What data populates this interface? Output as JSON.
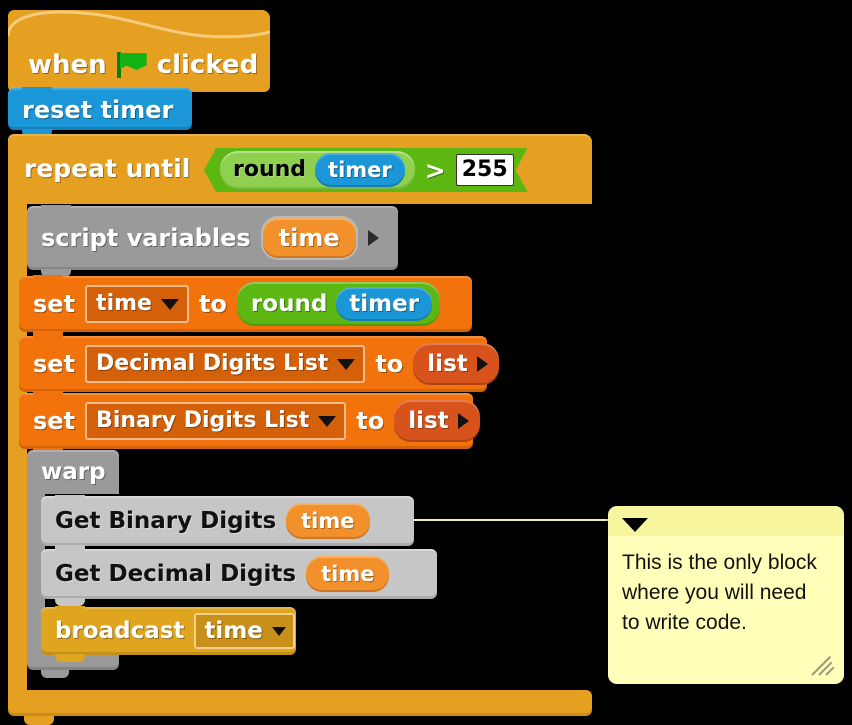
{
  "script": {
    "hat": {
      "label_when": "when",
      "label_clicked": "clicked",
      "icon": "green-flag-icon"
    },
    "reset_timer": {
      "label": "reset timer"
    },
    "repeat_until": {
      "label": "repeat until",
      "condition": {
        "round_label": "round",
        "timer_var": "timer",
        "operator": ">",
        "compare_value": "255"
      }
    },
    "script_variables": {
      "label": "script variables",
      "variables": [
        "time"
      ],
      "expand_arrow": "arrow-right-icon"
    },
    "set_blocks": [
      {
        "label": "set",
        "variable": "time",
        "to_label": "to",
        "value_kind": "round-timer",
        "round_label": "round",
        "timer_var": "timer"
      },
      {
        "label": "set",
        "variable": "Decimal Digits List",
        "to_label": "to",
        "value_kind": "list",
        "list_label": "list"
      },
      {
        "label": "set",
        "variable": "Binary Digits List",
        "to_label": "to",
        "value_kind": "list",
        "list_label": "list"
      }
    ],
    "warp": {
      "label": "warp"
    },
    "custom_blocks": [
      {
        "label": "Get Binary Digits",
        "argument": "time"
      },
      {
        "label": "Get Decimal Digits",
        "argument": "time"
      }
    ],
    "broadcast": {
      "label": "broadcast",
      "message": "time"
    }
  },
  "comment": {
    "text": "This is the only block where you will need to write code.",
    "collapse_icon": "triangle-down-icon",
    "resize_icon": "resize-handle-icon"
  },
  "colors": {
    "control_yellow": "#e5a022",
    "sensing_blue": "#1b96d6",
    "operator_green": "#5cb712",
    "operator_light_green": "#8fd14f",
    "variable_orange": "#f2720c",
    "list_red": "#d8531c",
    "other_gray": "#9a9a9a",
    "custom_gray": "#c6c6c6",
    "comment_yellow": "#ffffb9",
    "flag_green": "#12b312",
    "background": "#000000"
  }
}
